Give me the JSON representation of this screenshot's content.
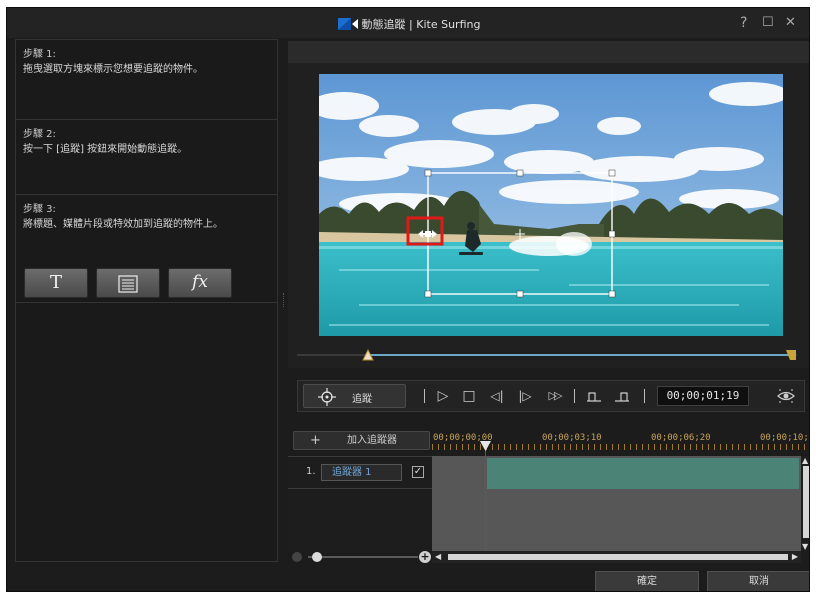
{
  "window": {
    "title": "動態追蹤 | Kite Surfing",
    "help_label": "?",
    "maximize_label": "☐",
    "close_label": "✕"
  },
  "steps": [
    {
      "title": "步驟 1:",
      "desc": "拖曳選取方塊來標示您想要追蹤的物件。"
    },
    {
      "title": "步驟 2:",
      "desc": "按一下 [追蹤] 按鈕來開始動態追蹤。"
    },
    {
      "title": "步驟 3:",
      "desc": "將標題、媒體片段或特效加到追蹤的物件上。"
    }
  ],
  "tools": {
    "title_label": "T",
    "fx_label": "fx"
  },
  "transport": {
    "track_label": "追蹤",
    "play": "▷",
    "stop": "□",
    "prev_frame": "◁|",
    "next_frame": "|▷",
    "fast_forward": "▷▷",
    "timecode": "00;00;01;19"
  },
  "timeline": {
    "add_tracker_label": "加入追蹤器",
    "ruler_labels": [
      "00;00;00;00",
      "00;00;03;10",
      "00;00;06;20",
      "00;00;10;"
    ],
    "track_index": "1.",
    "track_name": "追蹤器 1",
    "track_checked": "✓"
  },
  "footer": {
    "ok_label": "確定",
    "cancel_label": "取消"
  },
  "colors": {
    "accent_blue": "#6aa9c6",
    "clip_green": "#4b8376",
    "playhead_red": "#cc2a2a",
    "ruler_gold": "#c8a45a"
  }
}
